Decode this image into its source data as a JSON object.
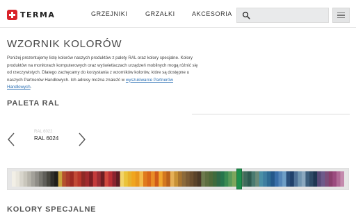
{
  "header": {
    "logo_text": "TERMA",
    "nav": [
      {
        "label": "GRZEJNIKI"
      },
      {
        "label": "GRZAŁKI"
      },
      {
        "label": "AKCESORIA"
      }
    ],
    "search": {
      "placeholder": "",
      "value": ""
    }
  },
  "page": {
    "title": "WZORNIK KOLORÓW",
    "intro_text": "Poniżej prezentujemy listę kolorów naszych produktów z palety RAL oraz kolory specjalne. Kolory produktów na monitorach komputerowych oraz wyświetlaczach urządzeń mobilnych mogą różnić się od rzeczywistych. Dlatego zachęcamy do korzystania z wzorników kolorów, które są dostępne u naszych Partnerów Handlowych. Ich adresy można znaleźć w ",
    "intro_link": "wyszukiwarce Partnerów Handlowych",
    "intro_end": "."
  },
  "ral_section": {
    "title": "PALETA RAL",
    "previous_label": "RAL 6022",
    "current_label": "RAL 6024",
    "selected_position": 0.685
  },
  "special_section": {
    "title": "KOLORY SPECJALNE"
  },
  "colors": {
    "brand_red": "#d9242b",
    "link_blue": "#2a6fb3",
    "selector_green": "#1f8f4d"
  },
  "palette_colors": [
    "#f2efe6",
    "#e9e6dc",
    "#d8d5cc",
    "#c9c6bc",
    "#b7b4ab",
    "#a3a19a",
    "#8e8c86",
    "#77766f",
    "#5f5e59",
    "#47463f",
    "#2f2e2a",
    "#1f1e1b",
    "#c8a33f",
    "#b5512e",
    "#a83b2c",
    "#9d2a23",
    "#c24a36",
    "#b8362b",
    "#8d2a26",
    "#a12b2e",
    "#7b1f24",
    "#c33b3b",
    "#9c2d34",
    "#6d1f23",
    "#d04a3f",
    "#b92f35",
    "#8a2430",
    "#5e1c24",
    "#f2d46a",
    "#eac33a",
    "#e8b12c",
    "#f0a51f",
    "#e8961f",
    "#f3b94a",
    "#e07a1d",
    "#d8661a",
    "#e98c27",
    "#cf5a1a",
    "#f0a630",
    "#d47820",
    "#b8611d",
    "#e5b057",
    "#c79136",
    "#a87530",
    "#8c6a3a",
    "#7a5b34",
    "#6b4f2f",
    "#5a432a",
    "#4a3826",
    "#6d7a4d",
    "#5d6e3f",
    "#4f6a3a",
    "#3f6b3d",
    "#2f6a48",
    "#27754d",
    "#3a8a52",
    "#5b9a5a",
    "#7da65c",
    "#a0b062",
    "#587b64",
    "#3f6b5c",
    "#2f5a50",
    "#4a7a70",
    "#6a8a78",
    "#4a8fa6",
    "#3e7ea0",
    "#2f6b93",
    "#25588a",
    "#3a6ea8",
    "#5586b8",
    "#6e9ec6",
    "#2b4f7a",
    "#20406a",
    "#4d6f95",
    "#7195b0",
    "#8aa8bf",
    "#3d5f7d",
    "#2e4a66",
    "#1f3652",
    "#5a4a78",
    "#6d5a8a",
    "#7d4d7a",
    "#8a3f6d",
    "#9b4a7e",
    "#b06a96",
    "#c48aad"
  ]
}
